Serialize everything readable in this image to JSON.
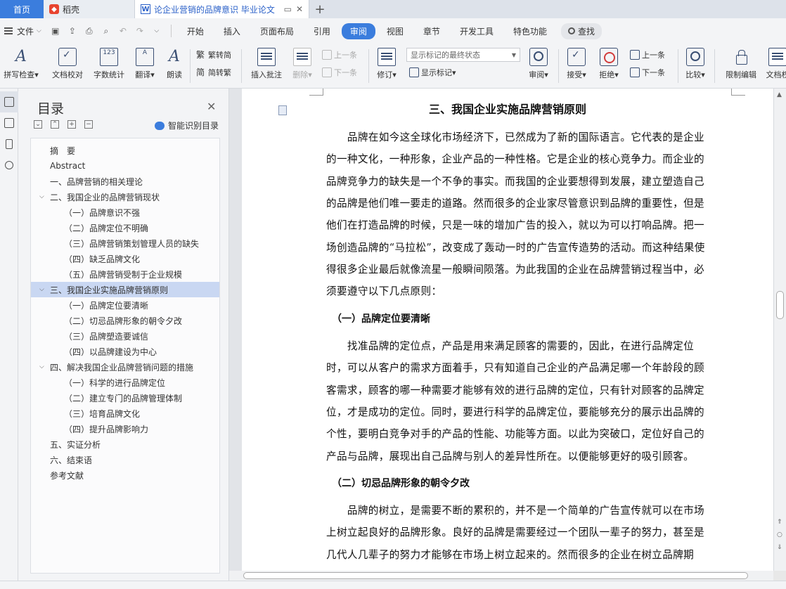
{
  "tabs": {
    "home": "首页",
    "daoke": "稻壳",
    "doc": "论企业营销的品牌意识 毕业论文",
    "add": "+"
  },
  "menu": {
    "file": "文件",
    "items": [
      "开始",
      "插入",
      "页面布局",
      "引用",
      "审阅",
      "视图",
      "章节",
      "开发工具",
      "特色功能"
    ],
    "active": "审阅",
    "search": "查找"
  },
  "ribbon": {
    "spellcheck": "拼写检查",
    "doc_check": "文档校对",
    "word_count": "字数统计",
    "translate": "翻译",
    "read_aloud": "朗读",
    "trad_conv": "繁转简",
    "simp_conv": "简转繁",
    "insert_comment": "插入批注",
    "delete": "删除",
    "prev": "上一条",
    "next": "下一条",
    "revise": "修订",
    "status_select": "显示标记的最终状态",
    "show_marks": "显示标记",
    "review": "审阅",
    "accept": "接受",
    "reject": "拒绝",
    "prev2": "上一条",
    "next2": "下一条",
    "compare": "比较",
    "restrict": "限制编辑",
    "doc_rights": "文档权"
  },
  "toc": {
    "title": "目录",
    "smart": "智能识别目录",
    "items": [
      {
        "text": "摘　要",
        "level": 0
      },
      {
        "text": "Abstract",
        "level": 0
      },
      {
        "text": "一、品牌营销的相关理论",
        "level": 0
      },
      {
        "text": "二、我国企业的品牌营销现状",
        "level": 0,
        "expanded": true
      },
      {
        "text": "（一）品牌意识不强",
        "level": 1
      },
      {
        "text": "（二）品牌定位不明确",
        "level": 1
      },
      {
        "text": "（三）品牌营销策划管理人员的缺失",
        "level": 1
      },
      {
        "text": "（四）缺乏品牌文化",
        "level": 1
      },
      {
        "text": "（五）品牌营销受制于企业规模",
        "level": 1
      },
      {
        "text": "三、我国企业实施品牌营销原则",
        "level": 0,
        "expanded": true,
        "selected": true
      },
      {
        "text": "（一）品牌定位要清晰",
        "level": 1
      },
      {
        "text": "（二）切忌品牌形象的朝令夕改",
        "level": 1
      },
      {
        "text": "（三）品牌塑造要诚信",
        "level": 1
      },
      {
        "text": "（四）以品牌建设为中心",
        "level": 1
      },
      {
        "text": "四、解决我国企业品牌营销问题的措施",
        "level": 0,
        "expanded": true
      },
      {
        "text": "（一）科学的进行品牌定位",
        "level": 1
      },
      {
        "text": "（二）建立专门的品牌管理体制",
        "level": 1
      },
      {
        "text": "（三）培育品牌文化",
        "level": 1
      },
      {
        "text": "（四）提升品牌影响力",
        "level": 1
      },
      {
        "text": "五、实证分析",
        "level": 0
      },
      {
        "text": "六、结束语",
        "level": 0
      },
      {
        "text": "参考文献",
        "level": 0
      }
    ]
  },
  "document": {
    "heading": "三、我国企业实施品牌营销原则",
    "para1": [
      "　　品牌在如今这全球化市场经济下，已然成为了新的国际语言。它代表的是企业",
      "的一种文化，一种形象，企业产品的一种性格。它是企业的核心竞争力。而企业的",
      "品牌竞争力的缺失是一个不争的事实。而我国的企业要想得到发展，建立塑造自己",
      "的品牌是他们唯一要走的道路。然而很多的企业家尽管意识到品牌的重要性，但是",
      "他们在打造品牌的时候，只是一味的增加广告的投入，就以为可以打响品牌。把一",
      "场创造品牌的“马拉松”，改变成了轰动一时的广告宣传造势的活动。而这种结果使",
      "得很多企业最后就像流星一般瞬间陨落。为此我国的企业在品牌营销过程当中，必",
      "须要遵守以下几点原则："
    ],
    "h_one": "（一）品牌定位要清晰",
    "para2": [
      "　　找准品牌的定位点，产品是用来满足顾客的需要的，因此，在进行品牌定位",
      "时，可以从客户的需求方面着手，只有知道自己企业的产品满足哪一个年龄段的顾",
      "客需求，顾客的哪一种需要才能够有效的进行品牌的定位，只有针对顾客的品牌定",
      "位，才是成功的定位。同时，要进行科学的品牌定位，要能够充分的展示出品牌的",
      "个性，要明白竞争对手的产品的性能、功能等方面。以此为突破口，定位好自己的",
      "产品与品牌，展现出自己品牌与别人的差异性所在。以便能够更好的吸引顾客。"
    ],
    "h_two": "（二）切忌品牌形象的朝令夕改",
    "para3": [
      "　　品牌的树立，是需要不断的累积的，并不是一个简单的广告宣传就可以在市场",
      "上树立起良好的品牌形象。良好的品牌是需要经过一个团队一辈子的努力，甚至是",
      "几代人几辈子的努力才能够在市场上树立起来的。然而很多的企业在树立品牌期"
    ]
  }
}
